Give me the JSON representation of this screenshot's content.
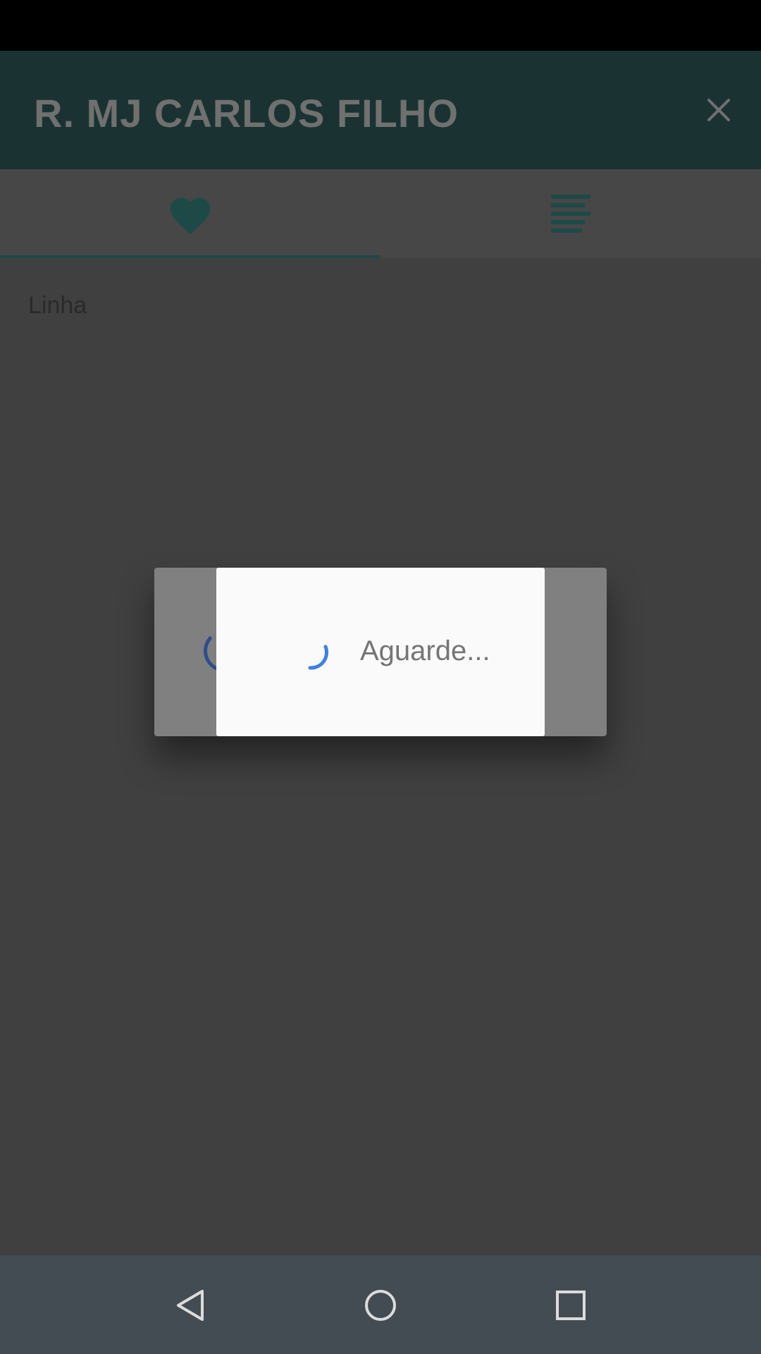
{
  "app_bar": {
    "title": "R. MJ CARLOS FILHO",
    "close_icon": "close-icon"
  },
  "tabs": [
    {
      "icon": "heart-icon",
      "selected": true
    },
    {
      "icon": "list-icon",
      "selected": false
    }
  ],
  "content": {
    "label": "Linha"
  },
  "dialog": {
    "message": "Aguarde...",
    "back_message_partial": "...",
    "spinner_color": "#3d7fe6"
  },
  "nav_bar": {
    "buttons": [
      "back-icon",
      "home-icon",
      "recents-icon"
    ]
  },
  "colors": {
    "app_bar": "#1a3332",
    "accent": "#1d4a47",
    "overlay": "#404040",
    "nav_bar": "#444c53"
  }
}
